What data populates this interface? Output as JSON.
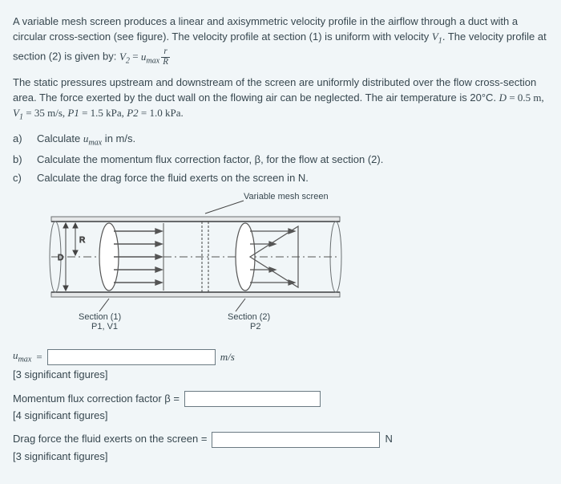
{
  "problem": {
    "para1_lead": "A variable mesh screen produces a linear and axisymmetric velocity profile in the airflow through a duct with a circular cross-section (see figure). The velocity profile at section (1) is uniform with velocity ",
    "para1_tail": ". The velocity profile at section (2) is given by: ",
    "eq_lhs_V": "V",
    "eq_lhs_sub": "2",
    "eq_eqs": " = ",
    "eq_rhs_u": "u",
    "eq_rhs_sub": "max",
    "frac_num": "r",
    "frac_den": "R",
    "para2": "The static pressures upstream and downstream of the screen are uniformly distributed over the flow cross-section area. The force exerted by the duct wall on the flowing air can be neglected. The air temperature is 20°C. ",
    "given_D_lbl": "D",
    "given_D_val": " = 0.5 m, ",
    "given_V1_lbl": "V",
    "given_V1_sub": "1",
    "given_V1_val": " = 35 m/s, ",
    "given_P1_lbl": "P1",
    "given_P1_val": " = 1.5 kPa, ",
    "given_P2_lbl": "P2",
    "given_P2_val": " = 1.0 kPa."
  },
  "parts": {
    "a_lbl": "a)",
    "a_txt_lead": "Calculate ",
    "a_txt_tail": " in m/s.",
    "b_lbl": "b)",
    "b_txt": "Calculate the momentum flux correction factor, β, for the flow at section (2).",
    "c_lbl": "c)",
    "c_txt": "Calculate the drag force the fluid exerts on the screen in N."
  },
  "figure": {
    "caption_top": "Variable mesh screen",
    "section1": "Section (1)",
    "p1v1": "P1, V1",
    "section2": "Section (2)",
    "p2": "P2",
    "R": "R",
    "D": "D"
  },
  "answers": {
    "umax_lbl_u": "u",
    "umax_lbl_sub": "max",
    "umax_eq": " = ",
    "umax_unit": "m/s",
    "umax_note": "[3 significant figures]",
    "beta_lbl": "Momentum flux correction factor β = ",
    "beta_note": "[4 significant figures]",
    "drag_lbl": "Drag force the fluid exerts on the screen = ",
    "drag_unit": "N",
    "drag_note": "[3 significant figures]"
  }
}
